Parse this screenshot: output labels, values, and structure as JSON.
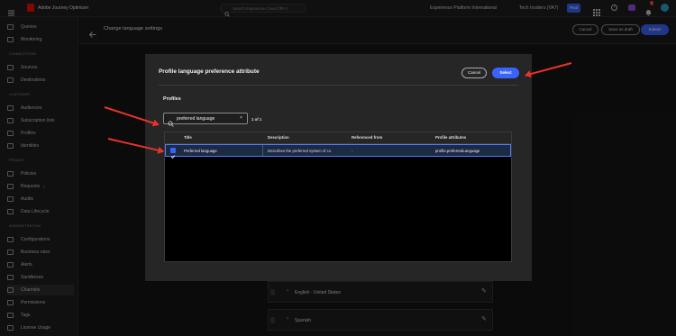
{
  "topbar": {
    "app_name": "Adobe Journey Optimizer",
    "search_placeholder": "Search Experience Cloud (⌘+/)",
    "org": "Experience Platform International",
    "sandbox": "Tech Insiders (VA7)",
    "env_badge": "Prod",
    "notif_count": "4"
  },
  "sidebar": {
    "top_items": [
      "Queries",
      "Monitoring"
    ],
    "sections": [
      {
        "heading": "CONNECTIONS",
        "items": [
          "Sources",
          "Destinations"
        ]
      },
      {
        "heading": "CUSTOMER",
        "items": [
          "Audiences",
          "Subscription lists",
          "Profiles",
          "Identities"
        ]
      },
      {
        "heading": "PRIVACY",
        "items": [
          "Policies",
          "Requests",
          "Audits",
          "Data Lifecycle"
        ]
      },
      {
        "heading": "ADMINISTRATION",
        "items": [
          "Configurations",
          "Business rules",
          "Alerts",
          "Sandboxes",
          "Channels",
          "Permissions",
          "Tags",
          "License Usage"
        ]
      }
    ],
    "selected": "Channels"
  },
  "page": {
    "title": "Change language settings",
    "cancel": "Cancel",
    "save_draft": "Save as draft",
    "submit": "Submit",
    "languages": [
      "English - United States",
      "Spanish"
    ]
  },
  "dialog": {
    "title": "Profile language preference attribute",
    "cancel": "Cancel",
    "select": "Select",
    "section": "Profiles",
    "search_value": "preferred language",
    "count": "1 of 1",
    "columns": [
      "Title",
      "Description",
      "Referenced from",
      "Profile attributes"
    ],
    "rows": [
      {
        "title": "Preferred language",
        "description": "Describes the preferred system of co",
        "referenced": "-",
        "attribute": "profile.preferredLanguage",
        "checked": true
      }
    ]
  },
  "colors": {
    "accent": "#3b63fb",
    "annotation": "#e8332b"
  }
}
